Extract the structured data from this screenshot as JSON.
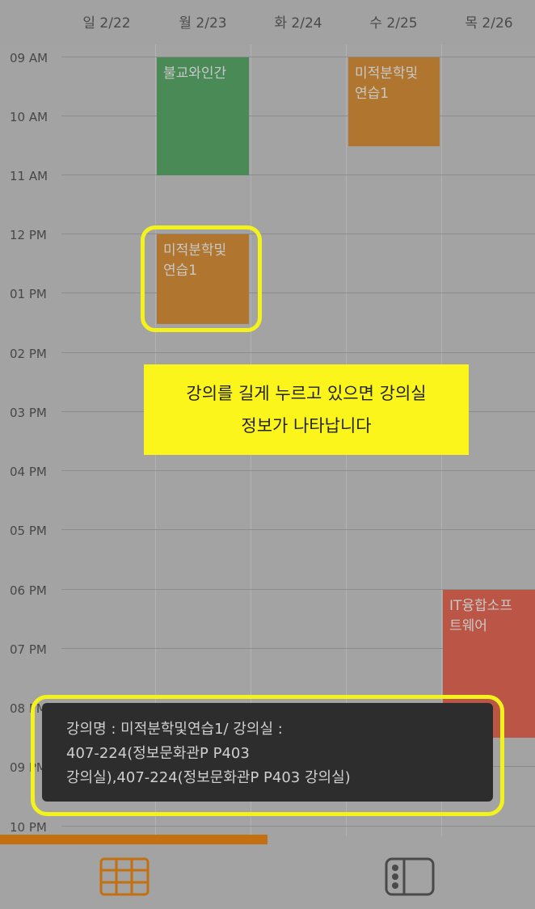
{
  "days": [
    "일 2/22",
    "월 2/23",
    "화 2/24",
    "수 2/25",
    "목 2/26"
  ],
  "times": [
    "09 AM",
    "10 AM",
    "11 AM",
    "12 PM",
    "01 PM",
    "02 PM",
    "03 PM",
    "04 PM",
    "05 PM",
    "06 PM",
    "07 PM",
    "08 PM",
    "09 PM",
    "10 PM"
  ],
  "events": {
    "buddhism_title": "불교와인간",
    "calc_wed_line1": "미적분학및",
    "calc_wed_line2": "연습1",
    "calc_mon_line1": "미적분학및",
    "calc_mon_line2": "연습1",
    "it_line1": "IT융합소프",
    "it_line2": "트웨어"
  },
  "tip": {
    "line1": "강의를 길게 누르고 있으면 강의실",
    "line2": "정보가 나타납니다"
  },
  "toast": {
    "line1": "강의명 : 미적분학및연습1/ 강의실 :",
    "line2": "407-224(정보문화관P P403",
    "line3": "강의실),407-224(정보문화관P P403 강의실)"
  },
  "colors": {
    "green_event": "#4a8a56",
    "orange_event": "#b07630",
    "red_event": "#bb5545",
    "tab_indicator": "#c27012",
    "highlight": "#f4f21c"
  },
  "icons": {
    "timetable": "grid-icon",
    "list": "list-icon"
  }
}
